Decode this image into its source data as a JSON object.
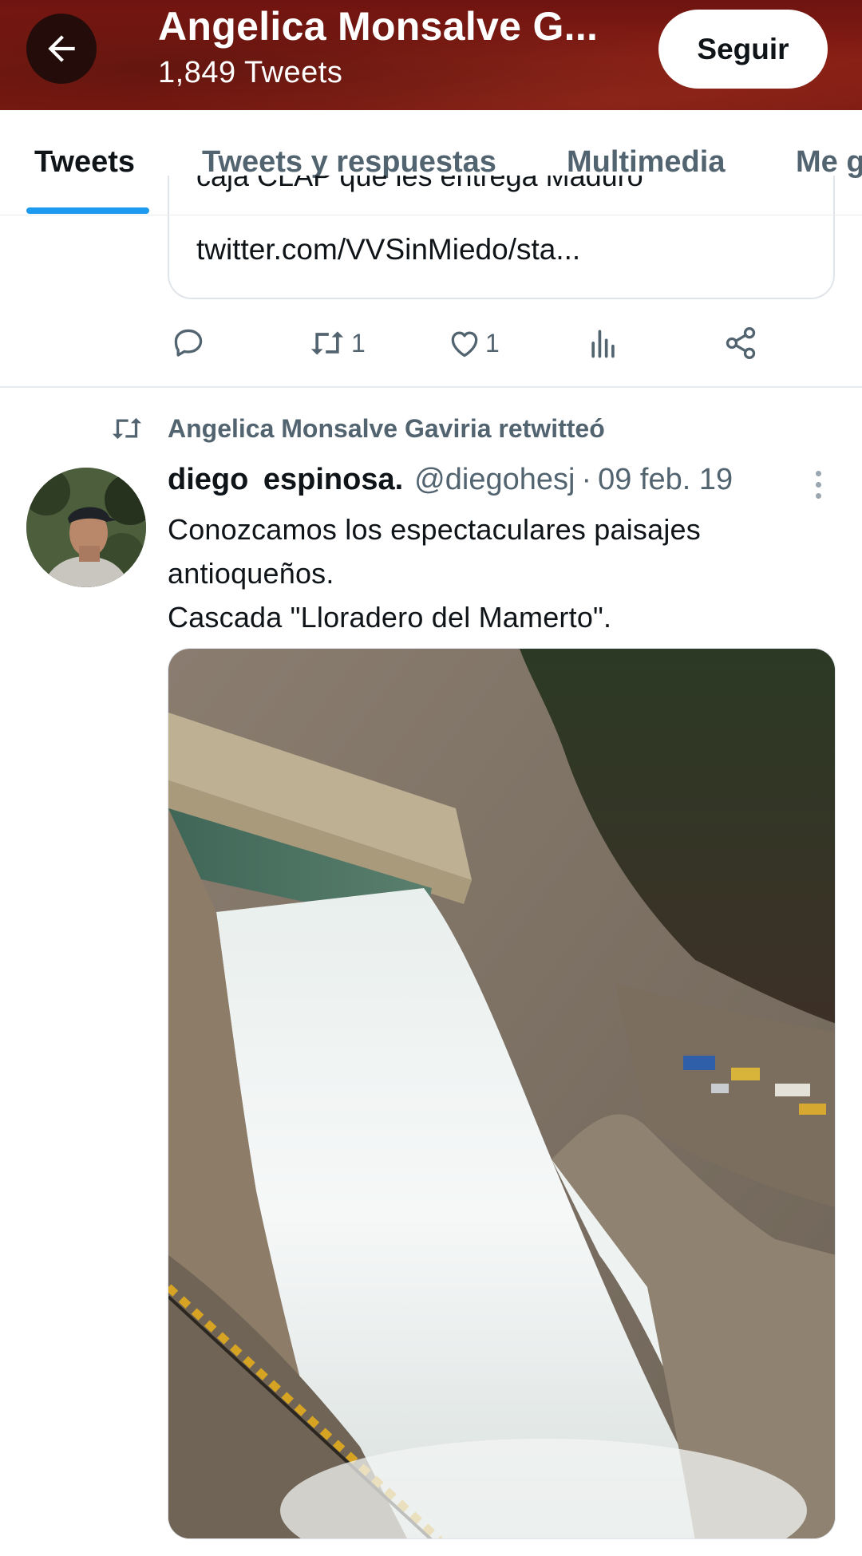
{
  "header": {
    "title": "Angelica Monsalve G...",
    "subtitle": "1,849 Tweets",
    "follow_label": "Seguir",
    "back_icon": "arrow-left-icon",
    "background_color": "#7f1a12"
  },
  "tabs": [
    {
      "label": "Tweets",
      "active": true
    },
    {
      "label": "Tweets y respuestas",
      "active": false
    },
    {
      "label": "Multimedia",
      "active": false
    },
    {
      "label": "Me g",
      "active": false
    }
  ],
  "accent_color": "#1d9bf0",
  "previous_tweet": {
    "quote_cut_text": "caja CLAP que les entrega Maduro",
    "quote_link": "twitter.com/VVSinMiedo/sta...",
    "actions": {
      "reply_count": "",
      "retweet_count": "1",
      "like_count": "1",
      "views_count": "",
      "share_count": ""
    }
  },
  "retweeted_tweet": {
    "retweet_label": "Angelica Monsalve Gaviria retwitteó",
    "author_name": "diego  espinosa.",
    "author_handle": "@diegohesj",
    "separator": "·",
    "date": "09 feb. 19",
    "text_lines": [
      "Conozcamos los espectaculares paisajes",
      "antioqueños.",
      "Cascada \"Lloradero del Mamerto\"."
    ],
    "media_description_icon": "waterfall-photo"
  }
}
